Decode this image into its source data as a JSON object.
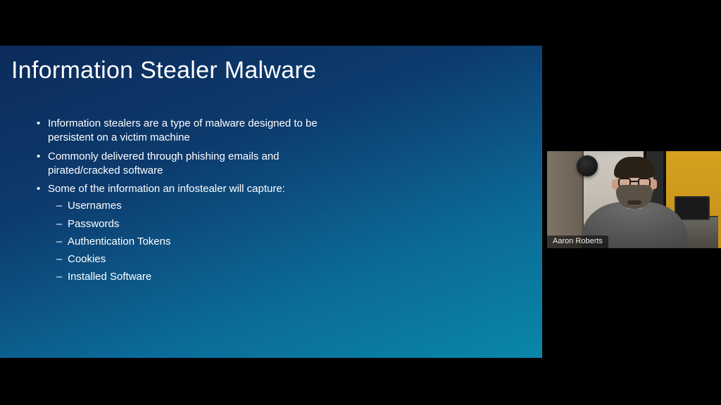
{
  "slide": {
    "title": "Information Stealer Malware",
    "bullets": [
      {
        "text": "Information stealers are a type of malware designed to be persistent on a victim machine"
      },
      {
        "text": "Commonly delivered through phishing emails and pirated/cracked software"
      },
      {
        "text": "Some of the information an infostealer will capture:",
        "sub": [
          "Usernames",
          "Passwords",
          "Authentication Tokens",
          "Cookies",
          "Installed Software"
        ]
      }
    ]
  },
  "speaker": {
    "name": "Aaron Roberts"
  }
}
